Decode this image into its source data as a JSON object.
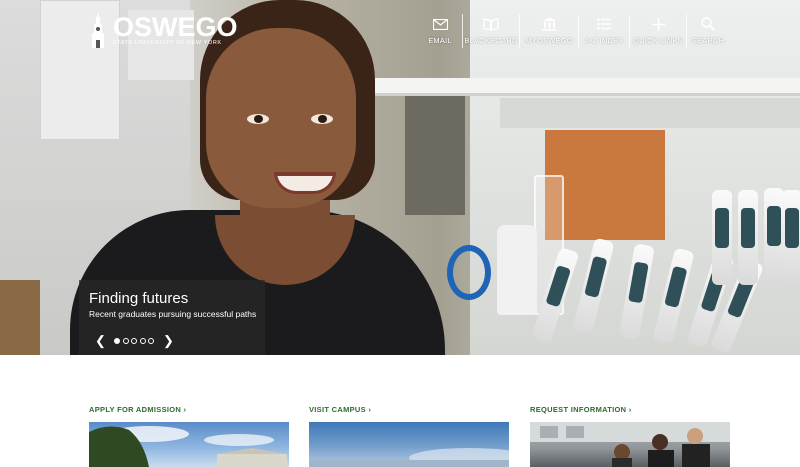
{
  "site": {
    "name": "OSWEGO",
    "tagline": "STATE UNIVERSITY OF NEW YORK"
  },
  "topnav": [
    {
      "label": "EMAIL",
      "icon": "mail-icon"
    },
    {
      "label": "BLACKBOARD",
      "icon": "book-icon"
    },
    {
      "label": "MYOSWEGO",
      "icon": "building-icon"
    },
    {
      "label": "A-Z INDEX",
      "icon": "list-icon"
    },
    {
      "label": "QUICK LINKS",
      "icon": "plus-icon"
    },
    {
      "label": "SEARCH",
      "icon": "search-icon"
    }
  ],
  "hero": {
    "title": "Finding futures",
    "subtitle": "Recent graduates pursuing successful paths",
    "prev": "❮",
    "next": "❯",
    "slides": 5,
    "active_slide": 1
  },
  "cards": [
    {
      "label": "APPLY FOR ADMISSION ›"
    },
    {
      "label": "VISIT CAMPUS ›"
    },
    {
      "label": "REQUEST INFORMATION ›"
    }
  ],
  "colors": {
    "accent_green": "#2e6b2f",
    "caption_bg": "rgba(40,40,40,0.72)"
  }
}
